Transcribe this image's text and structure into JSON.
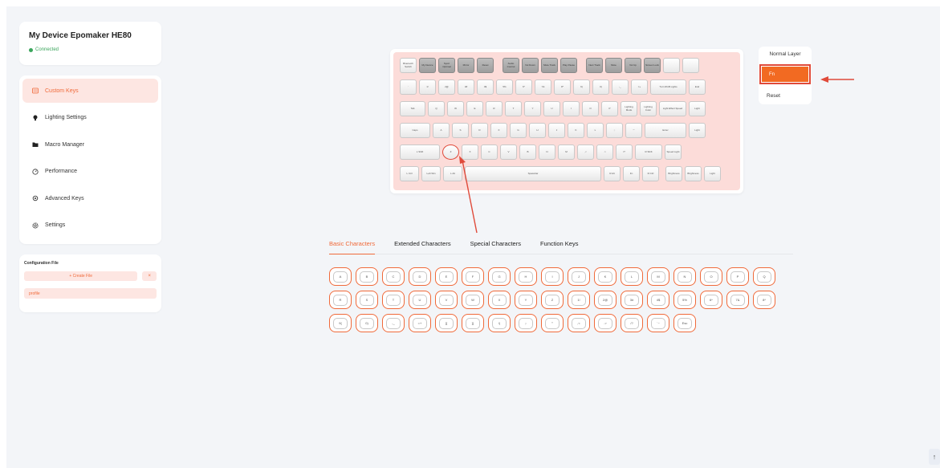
{
  "device": {
    "name": "My Device Epomaker HE80",
    "status": "Connected",
    "status_color": "#3ba55c"
  },
  "nav": {
    "items": [
      {
        "label": "Custom Keys",
        "icon": "keyboard-icon",
        "active": true
      },
      {
        "label": "Lighting Settings",
        "icon": "lightbulb-icon",
        "active": false
      },
      {
        "label": "Macro Manager",
        "icon": "folder-icon",
        "active": false
      },
      {
        "label": "Performance",
        "icon": "gauge-icon",
        "active": false
      },
      {
        "label": "Advanced Keys",
        "icon": "cog-icon",
        "active": false
      },
      {
        "label": "Settings",
        "icon": "gear-icon",
        "active": false
      }
    ]
  },
  "config": {
    "title": "Configuration File",
    "create_label": "+ Create File",
    "delete_label": "×",
    "profile_name": "profile"
  },
  "keyboard": {
    "rows": [
      [
        "Bluetooth Switch",
        "My Device",
        "Sport Optimal",
        "Mirror",
        "Reset",
        "Audio Control",
        "Vol Down",
        "Mute Track",
        "Play Pause",
        "Next Track",
        "Mute",
        "Vol Up",
        "Screen Lock",
        "",
        ""
      ],
      [
        "`",
        "1!",
        "2@",
        "3#",
        "4$",
        "5%",
        "6^",
        "7&",
        "8*",
        "9(",
        "0)",
        "-_",
        "=+",
        "Turn RGB Lights",
        "End"
      ],
      [
        "Tab",
        "Q",
        "W",
        "E",
        "R",
        "T",
        "Y",
        "U",
        "I",
        "O",
        "P",
        "Lighting Mode",
        "Lighting Color",
        "Light Effect Speed",
        "Light"
      ],
      [
        "Caps",
        "A",
        "S",
        "D",
        "F",
        "G",
        "H",
        "J",
        "K",
        "L",
        ";:",
        "'\"",
        "Enter",
        "Light"
      ],
      [
        "L Shift",
        "Z",
        "X",
        "C",
        "V",
        "B",
        "N",
        "M",
        ",<",
        ".>",
        "/?",
        "R Shift",
        "Speed Light"
      ],
      [
        "L Ctrl",
        "Left Win",
        "L Alt",
        "Spacebar",
        "R Alt",
        "Fn",
        "R Ctrl",
        "Brightness",
        "Brightness",
        "Light"
      ]
    ]
  },
  "layers": {
    "normal": "Normal Layer",
    "fn": "Fn",
    "reset": "Reset"
  },
  "tabs": [
    {
      "label": "Basic Characters",
      "active": true
    },
    {
      "label": "Extended Characters",
      "active": false
    },
    {
      "label": "Special Characters",
      "active": false
    },
    {
      "label": "Function Keys",
      "active": false
    }
  ],
  "chars": {
    "row1": [
      "A",
      "B",
      "C",
      "D",
      "E",
      "F",
      "G",
      "H",
      "I",
      "J",
      "K",
      "L",
      "M",
      "N",
      "O",
      "P",
      "Q"
    ],
    "row2": [
      "R",
      "S",
      "T",
      "U",
      "V",
      "W",
      "X",
      "Y",
      "Z",
      "1!",
      "2@",
      "3#",
      "4$",
      "5%",
      "6^",
      "7&",
      "8*"
    ],
    "row3": [
      "9(",
      "0)",
      "-_",
      "=+",
      "[{",
      "]}",
      "\\|",
      ";:",
      "'\"",
      ",<",
      ".>",
      "/?",
      "`~",
      "Esc"
    ]
  },
  "colors": {
    "accent": "#f06a3a",
    "accent_bg": "#fde6e2",
    "keyboard_bg": "#fcdcd9",
    "annotation_red": "#e04a3a"
  },
  "scroll_top_label": "↑"
}
